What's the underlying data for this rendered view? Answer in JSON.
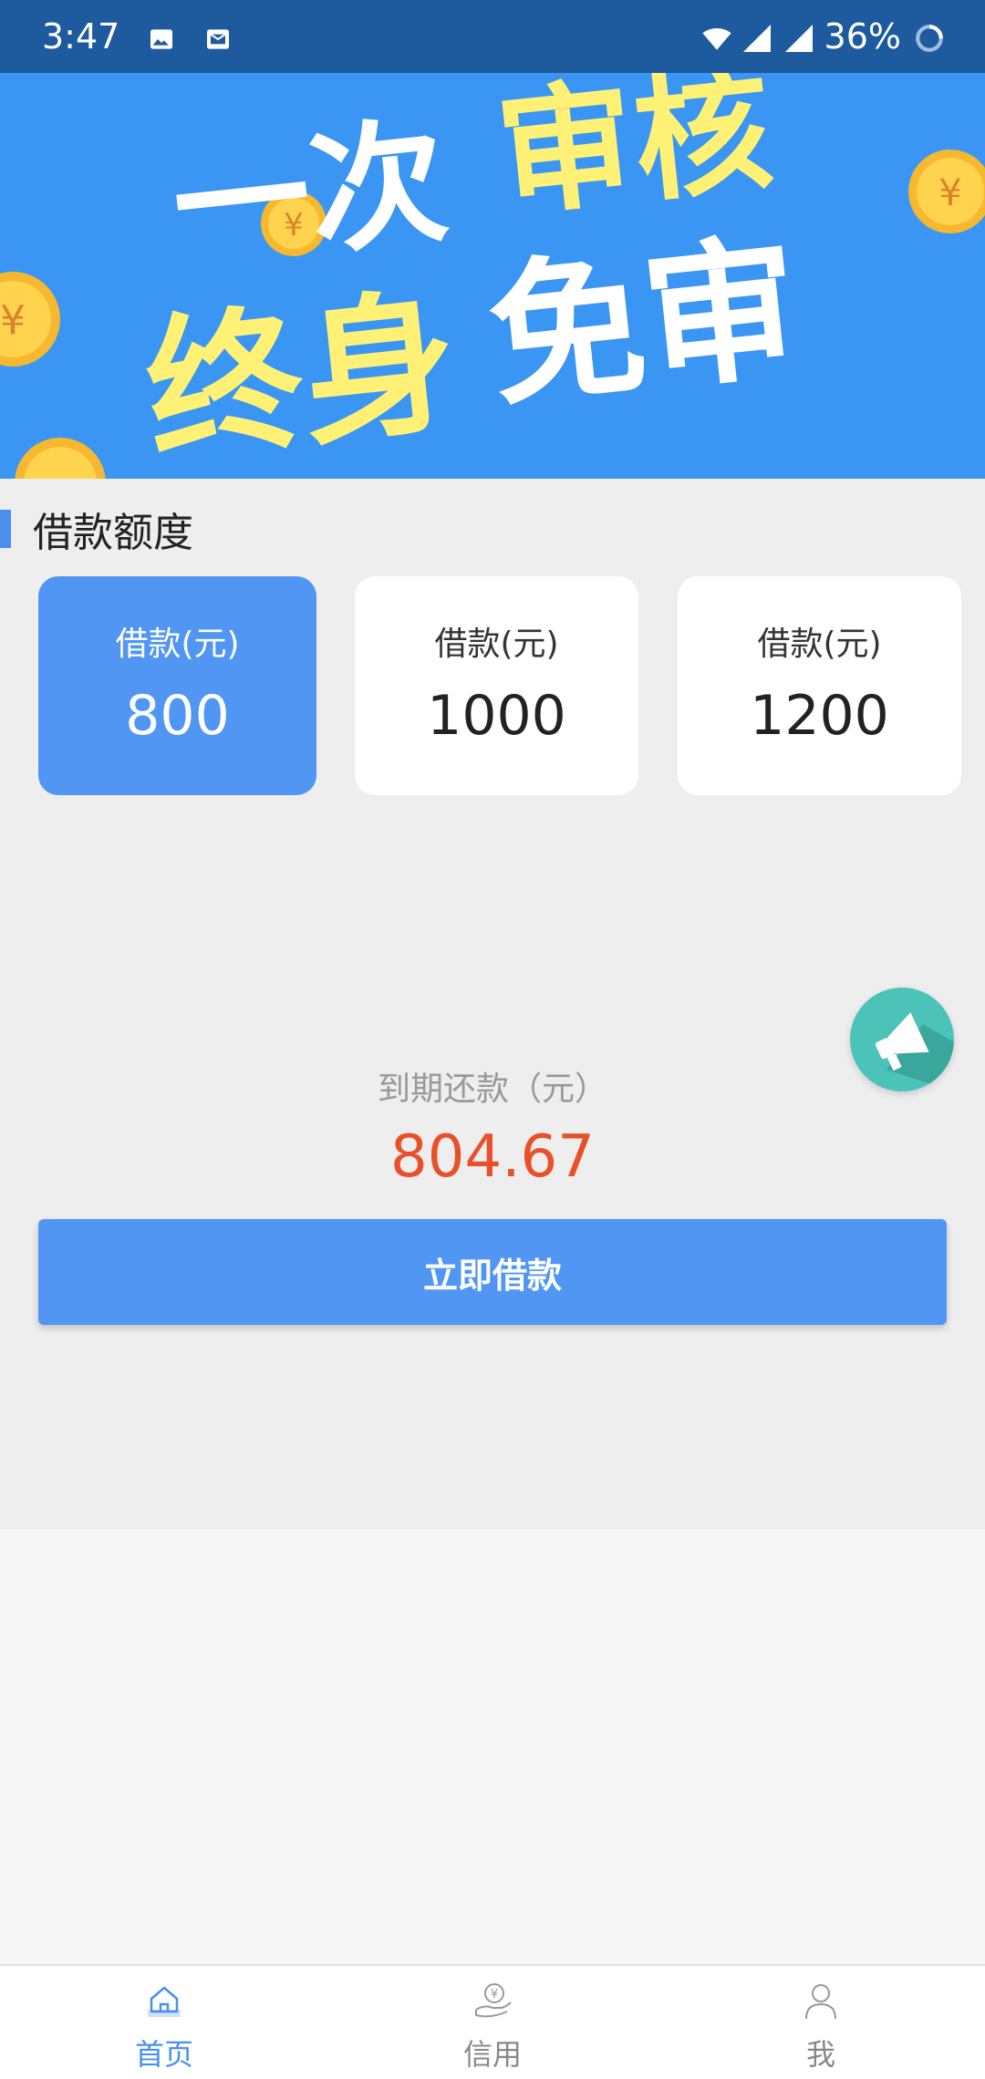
{
  "status_bar": {
    "time": "3:47",
    "battery": "36%",
    "icons": [
      "image-icon",
      "mail-icon",
      "wifi-icon",
      "signal-icon",
      "signal-icon",
      "battery-loading-icon"
    ]
  },
  "banner": {
    "line1_white": "一次",
    "line1_yellow": "审核",
    "line2_yellow": "终身",
    "line2_white": "免审",
    "coin_symbol": "¥"
  },
  "loan": {
    "section_title": "借款额度",
    "options": [
      {
        "label": "借款(元)",
        "value": "800",
        "selected": true
      },
      {
        "label": "借款(元)",
        "value": "1000",
        "selected": false
      },
      {
        "label": "借款(元)",
        "value": "1200",
        "selected": false
      }
    ],
    "due_label": "到期还款（元）",
    "due_value": "804.67",
    "submit_label": "立即借款"
  },
  "nav": {
    "items": [
      {
        "label": "首页",
        "icon": "home-icon",
        "active": true
      },
      {
        "label": "信用",
        "icon": "credit-icon",
        "active": false
      },
      {
        "label": "我",
        "icon": "profile-icon",
        "active": false
      }
    ]
  },
  "colors": {
    "primary": "#5096f2",
    "banner_bg": "#3a96f2",
    "status_bar": "#1e5a9e",
    "due_amount": "#e8502a",
    "fab": "#4cc3b8",
    "banner_yellow": "#fff176"
  }
}
